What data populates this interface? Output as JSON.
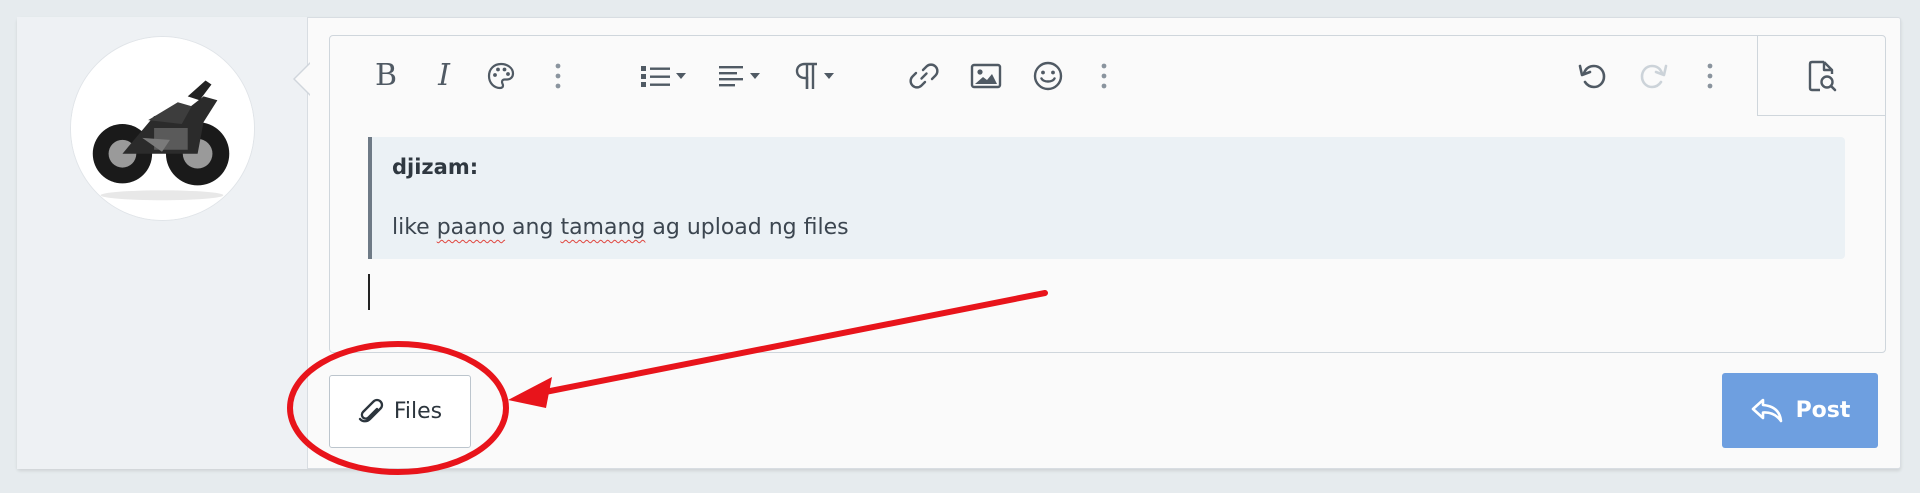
{
  "toolbar": {
    "buttons": [
      {
        "name": "bold-icon"
      },
      {
        "name": "italic-icon"
      },
      {
        "name": "palette-icon"
      },
      {
        "name": "more-options-icon"
      },
      {
        "name": "list-dropdown-icon"
      },
      {
        "name": "align-dropdown-icon"
      },
      {
        "name": "paragraph-dropdown-icon"
      },
      {
        "name": "link-icon"
      },
      {
        "name": "image-icon"
      },
      {
        "name": "emoji-icon"
      },
      {
        "name": "more-options-icon"
      },
      {
        "name": "undo-icon"
      },
      {
        "name": "redo-icon"
      },
      {
        "name": "more-options-icon"
      },
      {
        "name": "preview-icon"
      }
    ],
    "bold_label": "B",
    "italic_label": "I"
  },
  "quote": {
    "author": "djizam:",
    "text_parts": [
      "like ",
      "paano",
      " ang ",
      "tamang",
      " ag upload ng files"
    ]
  },
  "actions": {
    "files_label": "Files",
    "post_label": "Post"
  },
  "colors": {
    "accent": "#6e9fe0",
    "annotation": "#e8141b"
  }
}
